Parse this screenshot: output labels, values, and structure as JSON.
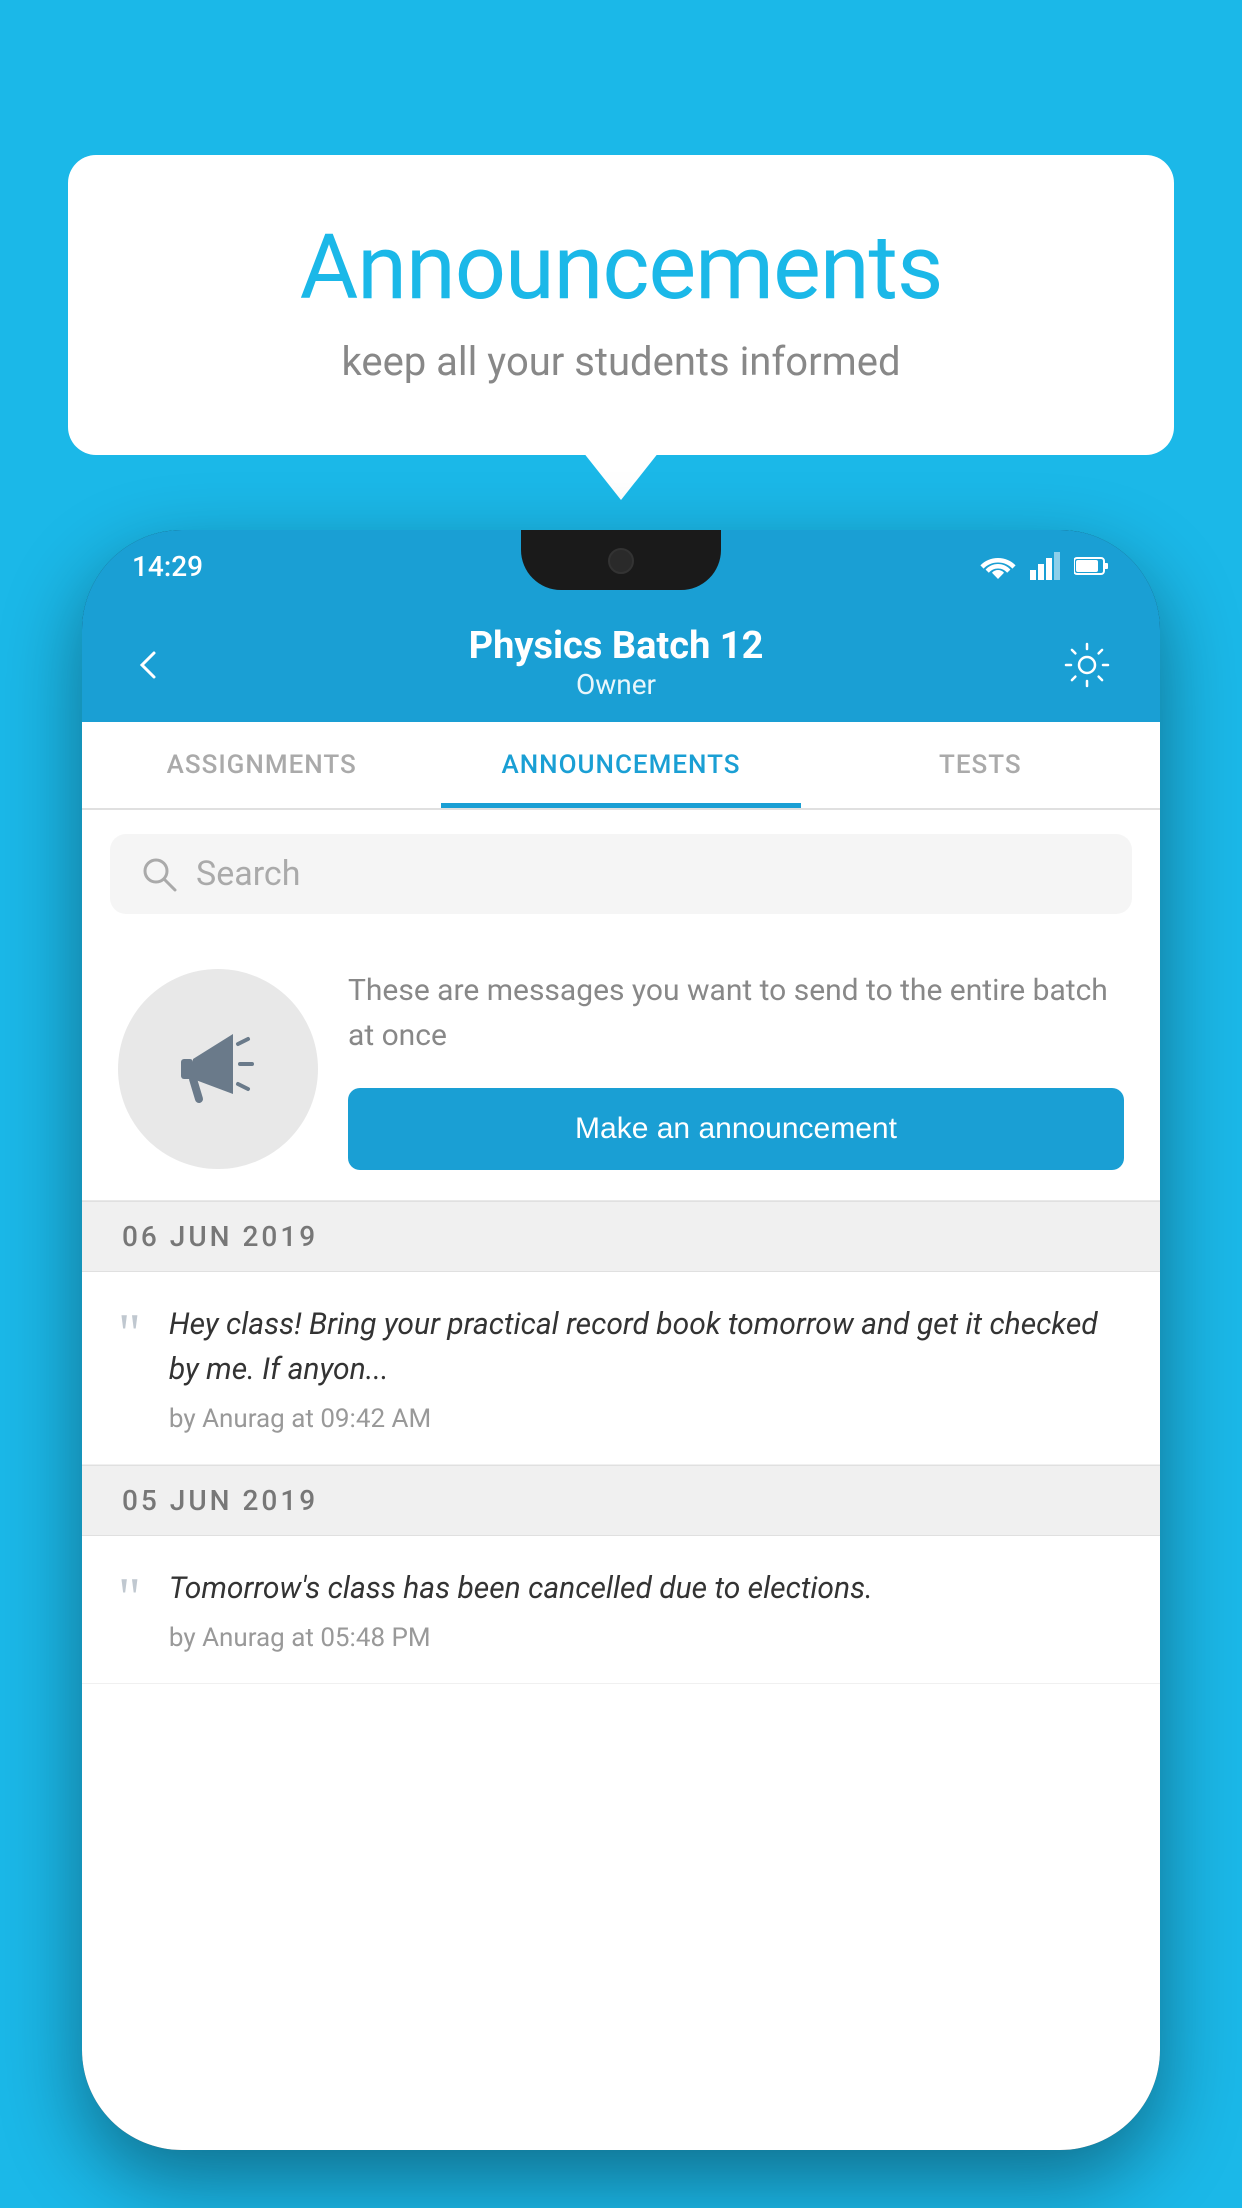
{
  "background_color": "#1BB8E8",
  "speech_bubble": {
    "title": "Announcements",
    "subtitle": "keep all your students informed"
  },
  "status_bar": {
    "time": "14:29",
    "wifi_icon": "wifi",
    "signal_icon": "signal",
    "battery_icon": "battery"
  },
  "app_bar": {
    "back_label": "←",
    "title": "Physics Batch 12",
    "subtitle": "Owner",
    "settings_icon": "⚙"
  },
  "tabs": [
    {
      "label": "ASSIGNMENTS",
      "active": false
    },
    {
      "label": "ANNOUNCEMENTS",
      "active": true
    },
    {
      "label": "TESTS",
      "active": false
    },
    {
      "label": "▸",
      "active": false
    }
  ],
  "search": {
    "placeholder": "Search"
  },
  "promo": {
    "description": "These are messages you want to send to the entire batch at once",
    "button_label": "Make an announcement"
  },
  "announcements": [
    {
      "date_header": "06  JUN  2019",
      "message": "Hey class! Bring your practical record book tomorrow and get it checked by me. If anyon...",
      "author": "by Anurag at 09:42 AM"
    },
    {
      "date_header": "05  JUN  2019",
      "message": "Tomorrow's class has been cancelled due to elections.",
      "author": "by Anurag at 05:48 PM"
    }
  ]
}
